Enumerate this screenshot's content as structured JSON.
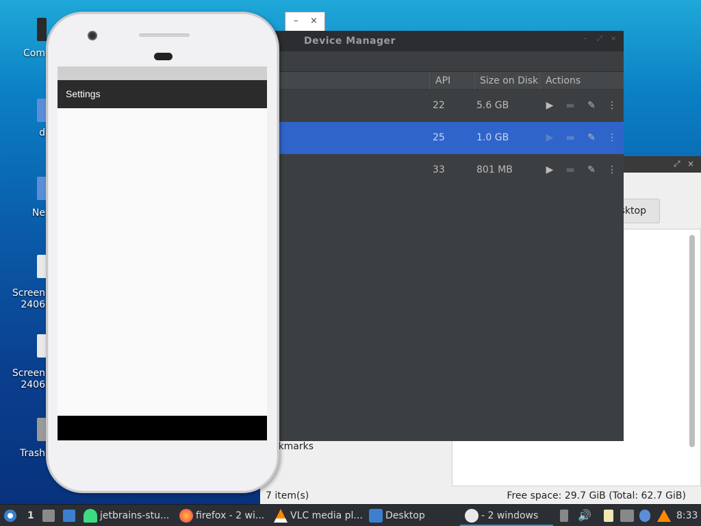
{
  "desktop": {
    "icons": [
      {
        "label": "Com"
      },
      {
        "label": "d"
      },
      {
        "label": "Ne"
      },
      {
        "label_1": "Screen",
        "label_2": "2406"
      },
      {
        "label_1": "Screen",
        "label_2": "2406"
      },
      {
        "label": "Trash"
      }
    ]
  },
  "mini_window": {
    "minimize": "–",
    "close": "×"
  },
  "file_manager": {
    "path_button": "esktop",
    "bookmarks_label": "okmarks",
    "status_items": "7 item(s)",
    "free_space": "Free space: 29.7 GiB (Total: 62.7 GiB)"
  },
  "device_manager": {
    "title": "Device Manager",
    "columns": {
      "api": "API",
      "size": "Size on Disk",
      "actions": "Actions"
    },
    "rows": [
      {
        "api": "22",
        "size": "5.6 GB",
        "selected": false
      },
      {
        "api": "25",
        "size": "1.0 GB",
        "selected": true
      },
      {
        "api": "33",
        "size": "801 MB",
        "selected": false
      }
    ],
    "action_icons": [
      "play-icon",
      "folder-icon",
      "edit-icon",
      "more-icon"
    ]
  },
  "emulator": {
    "app_title": "Settings"
  },
  "taskbar": {
    "workspace": "1",
    "items": [
      {
        "label": "jetbrains-stu...",
        "icon": "android-icon"
      },
      {
        "label": "firefox - 2 wi...",
        "icon": "firefox-icon"
      },
      {
        "label": "VLC media pl...",
        "icon": "vlc-icon"
      },
      {
        "label": "Desktop",
        "icon": "folder-icon"
      },
      {
        "label": "- 2 windows",
        "icon": "studio-icon"
      }
    ],
    "clock": "8:33"
  }
}
